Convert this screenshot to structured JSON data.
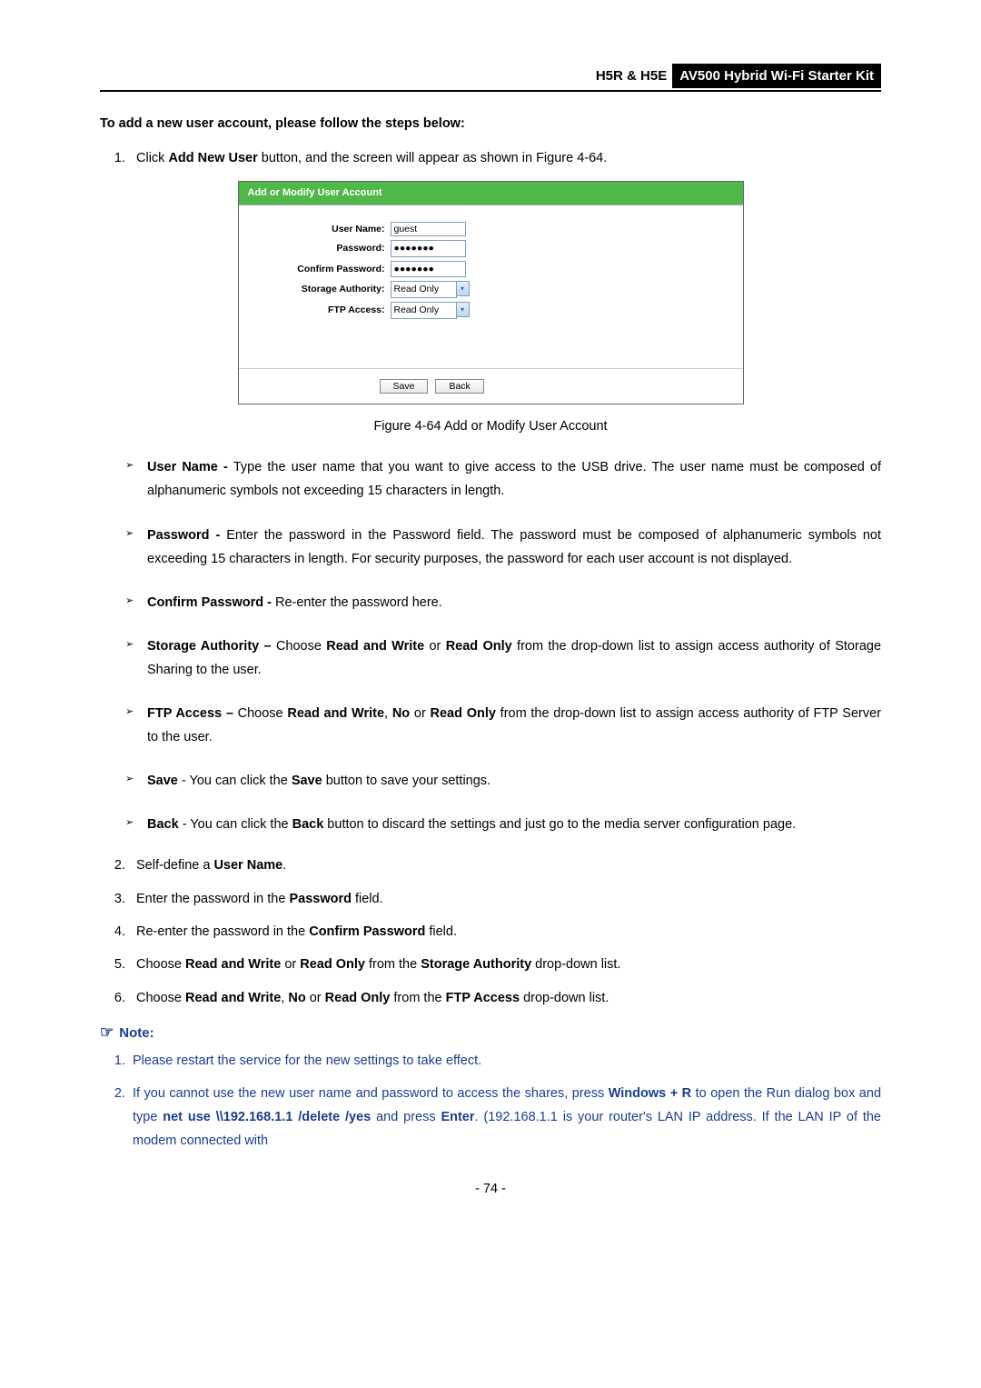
{
  "header": {
    "model": "H5R & H5E",
    "kit": "AV500 Hybrid Wi-Fi Starter Kit"
  },
  "section_title": "To add a new user account, please follow the steps below:",
  "step1_prefix": "Click ",
  "step1_bold": "Add New User",
  "step1_suffix": " button, and the screen will appear as shown in Figure 4-64.",
  "figure": {
    "header": "Add or Modify User Account",
    "labels": {
      "username": "User Name:",
      "password": "Password:",
      "confirm": "Confirm Password:",
      "storage": "Storage Authority:",
      "ftp": "FTP Access:"
    },
    "values": {
      "username": "guest",
      "password": "●●●●●●●",
      "confirm": "●●●●●●●",
      "storage": "Read Only",
      "ftp": "Read Only"
    },
    "buttons": {
      "save": "Save",
      "back": "Back"
    }
  },
  "figure_caption": "Figure 4-64 Add or Modify User Account",
  "bullets": {
    "b1_t": "User Name - ",
    "b1_b": "Type the user name that you want to give access to the USB drive. The user name must be composed of alphanumeric symbols not exceeding 15 characters in length.",
    "b2_t": "Password - ",
    "b2_b": "Enter the password in the Password field. The password must be composed of alphanumeric symbols not exceeding 15 characters in length. For security purposes, the password for each user account is not displayed.",
    "b3_t": "Confirm Password - ",
    "b3_b": "Re-enter the password here.",
    "b4_t": "Storage Authority – ",
    "b4_mid1": "Choose ",
    "b4_rw": "Read and Write",
    "b4_or": " or ",
    "b4_ro": "Read Only",
    "b4_end": " from the drop-down list to assign access authority of Storage Sharing to the user.",
    "b5_t": "FTP Access – ",
    "b5_mid1": "Choose ",
    "b5_rw": "Read and Write",
    "b5_c1": ", ",
    "b5_no": "No",
    "b5_or": " or ",
    "b5_ro": "Read Only",
    "b5_end": " from the drop-down list to assign access authority of FTP Server to the user.",
    "b6_t": "Save",
    "b6_mid": " - You can click the ",
    "b6_btn": "Save",
    "b6_end": " button to save your settings.",
    "b7_t": "Back",
    "b7_mid": " - You can click the ",
    "b7_btn": "Back",
    "b7_end": " button to discard the settings and just go to the media server configuration page."
  },
  "steps2": {
    "s2a": "Self-define a ",
    "s2b": "User Name",
    "s2c": ".",
    "s3a": "Enter the password in the ",
    "s3b": "Password",
    "s3c": " field.",
    "s4a": "Re-enter the password in the ",
    "s4b": "Confirm Password",
    "s4c": " field.",
    "s5a": "Choose ",
    "s5b": "Read and Write",
    "s5c": " or ",
    "s5d": "Read Only",
    "s5e": " from the ",
    "s5f": "Storage Authority",
    "s5g": " drop-down list.",
    "s6a": "Choose ",
    "s6b": "Read and Write",
    "s6c": ", ",
    "s6d": "No",
    "s6e": " or ",
    "s6f": "Read Only",
    "s6g": " from the ",
    "s6h": "FTP Access",
    "s6i": " drop-down list."
  },
  "note": {
    "title": "Note:",
    "n1": "Please restart the service for the new settings to take effect.",
    "n2a": "If you cannot use the new user name and password to access the shares, press ",
    "n2b": "Windows + R",
    "n2c": " to open the Run dialog box and type ",
    "n2d": "net use \\\\192.168.1.1 /delete /yes",
    "n2e": " and press ",
    "n2f": "Enter",
    "n2g": ". (192.168.1.1 is your router's LAN IP address. If the LAN IP of the modem connected with"
  },
  "page_num": "- 74 -"
}
